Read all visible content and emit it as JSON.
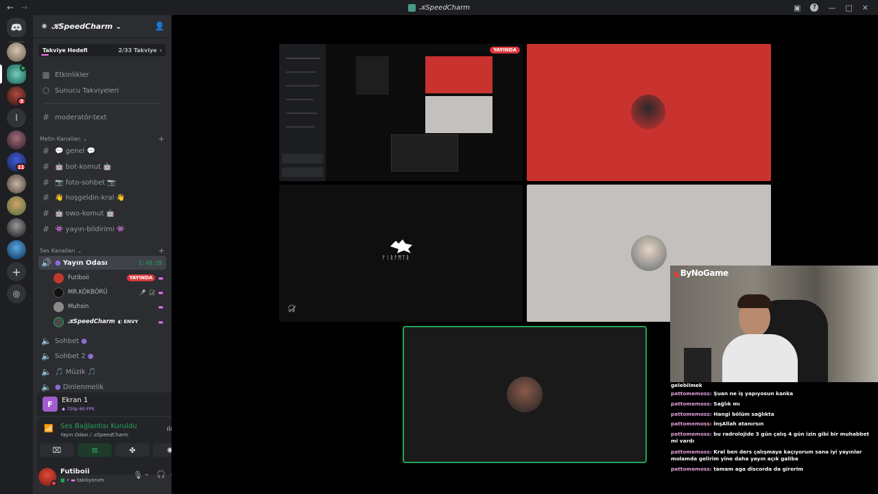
{
  "window": {
    "title": "𝒦SpeedCharm"
  },
  "server": {
    "name": "𝒦SpeedCharm",
    "boost": {
      "label": "Takviye Hedefi",
      "count": "2/33 Takviye",
      "progress": 0.06
    }
  },
  "guild_badges": {
    "dm": "3",
    "g5": "11"
  },
  "top_items": [
    {
      "icon": "calendar-icon",
      "label": "Etkinlikler"
    },
    {
      "icon": "boost-icon",
      "label": "Sunucu Takviyeleri"
    }
  ],
  "pinned_channel": {
    "label": "moderatör-text"
  },
  "text_category": {
    "label": "Metin Kanalları"
  },
  "text_channels": [
    {
      "label": "💬 genel 💬"
    },
    {
      "label": "🤖 bot-komut 🤖"
    },
    {
      "label": "📷 foto-sohbet 📷"
    },
    {
      "label": "👋 hoşgeldin-kral 👋"
    },
    {
      "label": "🤖 owo-komut 🤖"
    },
    {
      "label": "👾 yayın-bildirimi 👾"
    }
  ],
  "voice_category": {
    "label": "Ses Kanalları"
  },
  "active_voice": {
    "label": "Yayın Odası",
    "timer": "1:48:28"
  },
  "voice_users": [
    {
      "name": "Futiboii",
      "badge": "YAYINDA",
      "color": "#c0392b"
    },
    {
      "name": "MR.KÖKBÖRÜ",
      "badge": "",
      "color": "#111111"
    },
    {
      "name": "Muhsin",
      "badge": "",
      "color": "#777777"
    },
    {
      "name": "𝒦SpeedCharm",
      "badge": "",
      "tag": "ENVY",
      "color": "#4a4a4a"
    }
  ],
  "voice_channels": [
    {
      "label": "Sohbet"
    },
    {
      "label": "Sohbet 2"
    },
    {
      "label": "🎵 Müzik 🎵"
    },
    {
      "label": "Dinlenmelik"
    }
  ],
  "screen_panel": {
    "initial": "F",
    "title": "Ekran 1",
    "quality": "720p 60 FPS"
  },
  "voice_panel": {
    "status": "Ses Bağlantısı Kuruldu",
    "location": "Yayın Odası / 𝒦SpeedCharm"
  },
  "user_panel": {
    "name": "Futiboii",
    "status": "takılıyorum"
  },
  "stream": {
    "live_label": "YAYINDA",
    "rune_text": "ᚠᛁᚱᚨᛗᛏᚱ"
  },
  "webcam": {
    "logo": "ByNoGame"
  },
  "chat_messages": [
    {
      "user": "",
      "text": "gelebilmek"
    },
    {
      "user": "pattomemoss:",
      "text": "Şuan ne iş yapıyosun kanka"
    },
    {
      "user": "pattomemoss:",
      "text": "Sağlık mı"
    },
    {
      "user": "pattomemoss:",
      "text": "Hangi bölüm sağlıkta"
    },
    {
      "user": "pattomemoss:",
      "text": "İnşAllah atanırsın"
    },
    {
      "user": "pattomemoss:",
      "text": "bu radrolojide 3 gün çalış 4 gün izin gibi bir muhabbet mi vardı"
    },
    {
      "user": "pattomemoss:",
      "text": "Kral ben ders çalışmaya kaçıyorum sana iyi yayınlar molamda gelirim yine daha yayın açık galiba"
    },
    {
      "user": "pattomemoss:",
      "text": "tamam aga discorda da girerim"
    }
  ],
  "colors": {
    "accent_green": "#23a55a",
    "live_red": "#da373c",
    "tile_red": "#c8322f",
    "tile_gray": "#c3c0bd"
  }
}
